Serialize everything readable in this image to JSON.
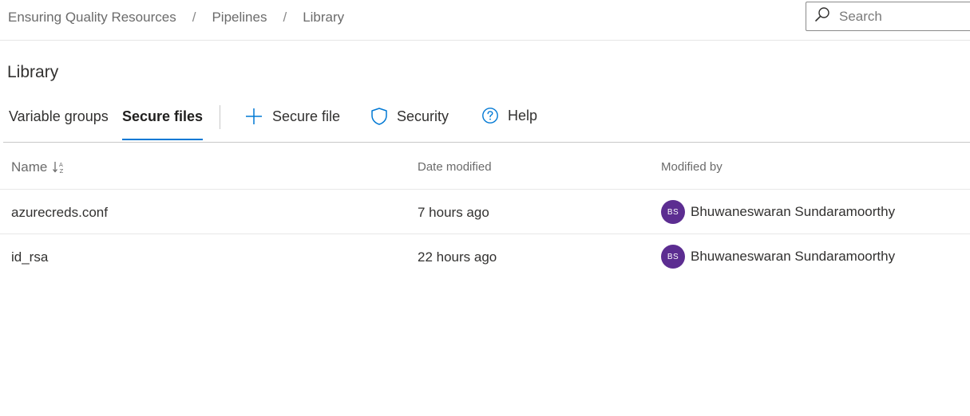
{
  "breadcrumb": {
    "items": [
      "Ensuring Quality Resources",
      "Pipelines",
      "Library"
    ],
    "separator": "/"
  },
  "search": {
    "placeholder": "Search",
    "icon": "search-icon"
  },
  "page": {
    "title": "Library"
  },
  "tabs": [
    {
      "label": "Variable groups",
      "active": false
    },
    {
      "label": "Secure files",
      "active": true
    }
  ],
  "commands": [
    {
      "label": "Secure file",
      "icon": "plus-icon"
    },
    {
      "label": "Security",
      "icon": "shield-icon"
    },
    {
      "label": "Help",
      "icon": "help-icon"
    }
  ],
  "table": {
    "columns": {
      "name": "Name",
      "date": "Date modified",
      "modified_by": "Modified by"
    },
    "rows": [
      {
        "name": "azurecreds.conf",
        "date": "7 hours ago",
        "avatar": "BS",
        "user": "Bhuwaneswaran Sundaramoorthy"
      },
      {
        "name": "id_rsa",
        "date": "22 hours ago",
        "avatar": "BS",
        "user": "Bhuwaneswaran Sundaramoorthy"
      }
    ]
  },
  "colors": {
    "accent": "#0078d4",
    "avatar": "#5c2d91",
    "text": "#323130",
    "muted": "#6b6b6b"
  }
}
